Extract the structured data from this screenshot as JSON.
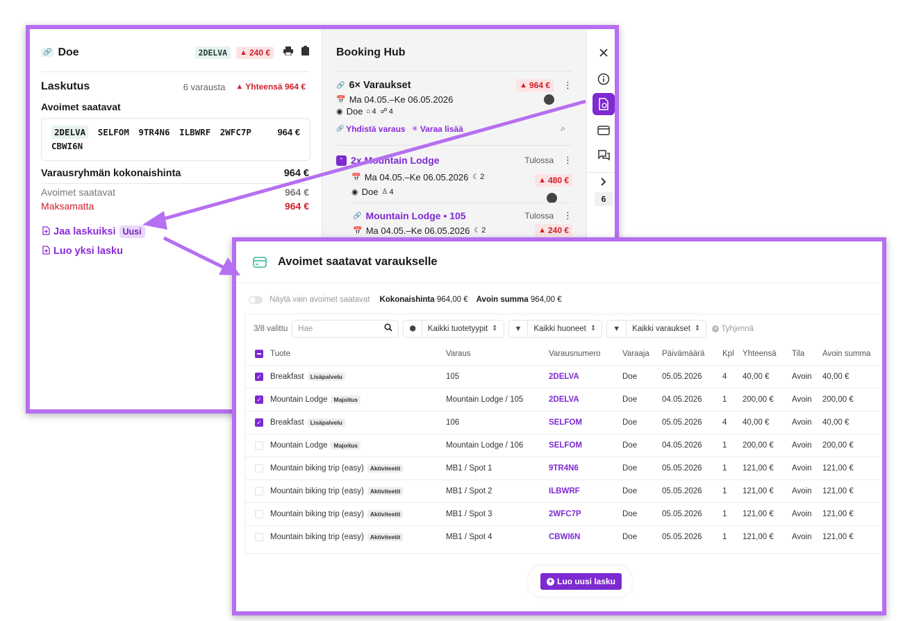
{
  "panel1": {
    "header": {
      "title": "Doe",
      "booking_code": "2DELVA",
      "balance": "240 €"
    },
    "laskutus": {
      "title": "Laskutus",
      "count": "6 varausta",
      "total": "Yhteensä 964 €"
    },
    "avoimet": {
      "title": "Avoimet saatavat",
      "codes": [
        "2DELVA",
        "SELFOM",
        "9TR4N6",
        "ILBWRF",
        "2WFC7P",
        "CBWI6N"
      ],
      "amount": "964 €"
    },
    "group_total": {
      "label": "Varausryhmän kokonaishinta",
      "amount": "964 €",
      "open_label": "Avoimet saatavat",
      "open_amount": "964 €",
      "unpaid_label": "Maksamatta",
      "unpaid_amount": "964 €"
    },
    "actions": {
      "split_label": "Jaa laskuiksi",
      "split_badge": "Uusi",
      "single_label": "Luo yksi lasku"
    },
    "hub": {
      "title": "Booking Hub",
      "group": {
        "title": "6× Varaukset",
        "balance": "964 €",
        "dates": "Ma 04.05.–Ke 06.05.2026",
        "guest": "Doe",
        "rooms": "4",
        "people": "4",
        "merge_label": "Yhdistä varaus",
        "book_more_label": "Varaa lisää"
      },
      "lodge": {
        "title": "2x Mountain Lodge",
        "status": "Tulossa",
        "dates": "Ma 04.05.–Ke 06.05.2026",
        "nights": "2",
        "balance": "480 €",
        "guest": "Doe",
        "people": "4"
      },
      "room": {
        "title": "Mountain Lodge • 105",
        "status": "Tulossa",
        "dates": "Ma 04.05.–Ke 06.05.2026",
        "nights": "2",
        "balance": "240 €"
      }
    },
    "sidebar": {
      "collapse_count": "6"
    }
  },
  "panel2": {
    "title": "Avoimet saatavat varaukselle",
    "summary": {
      "toggle_label": "Näytä vain avoimet saatavat",
      "total_label": "Kokonaishinta",
      "total_value": "964,00 €",
      "open_label": "Avoin summa",
      "open_value": "964,00 €"
    },
    "filters": {
      "selected_count": "3/8 valittu",
      "search_placeholder": "Hae",
      "product_types": "Kaikki tuotetyypit",
      "rooms": "Kaikki huoneet",
      "bookings": "Kaikki varaukset",
      "clear": "Tyhjennä"
    },
    "columns": [
      "Tuote",
      "Varaus",
      "Varausnumero",
      "Varaaja",
      "Päivämäärä",
      "Kpl",
      "Yhteensä",
      "Tila",
      "Avoin summa"
    ],
    "rows": [
      {
        "checked": true,
        "product": "Breakfast",
        "category": "Lisäpalvelu",
        "booking": "105",
        "code": "2DELVA",
        "guest": "Doe",
        "date": "05.05.2026",
        "qty": "4",
        "total": "40,00 €",
        "status": "Avoin",
        "open": "40,00 €"
      },
      {
        "checked": true,
        "product": "Mountain Lodge",
        "category": "Majoitus",
        "booking": "Mountain Lodge / 105",
        "code": "2DELVA",
        "guest": "Doe",
        "date": "04.05.2026",
        "qty": "1",
        "total": "200,00 €",
        "status": "Avoin",
        "open": "200,00 €"
      },
      {
        "checked": true,
        "product": "Breakfast",
        "category": "Lisäpalvelu",
        "booking": "106",
        "code": "SELFOM",
        "guest": "Doe",
        "date": "05.05.2026",
        "qty": "4",
        "total": "40,00 €",
        "status": "Avoin",
        "open": "40,00 €"
      },
      {
        "checked": false,
        "product": "Mountain Lodge",
        "category": "Majoitus",
        "booking": "Mountain Lodge / 106",
        "code": "SELFOM",
        "guest": "Doe",
        "date": "04.05.2026",
        "qty": "1",
        "total": "200,00 €",
        "status": "Avoin",
        "open": "200,00 €"
      },
      {
        "checked": false,
        "product": "Mountain biking trip (easy)",
        "category": "Aktiviteetit",
        "booking": "MB1 / Spot 1",
        "code": "9TR4N6",
        "guest": "Doe",
        "date": "05.05.2026",
        "qty": "1",
        "total": "121,00 €",
        "status": "Avoin",
        "open": "121,00 €"
      },
      {
        "checked": false,
        "product": "Mountain biking trip (easy)",
        "category": "Aktiviteetit",
        "booking": "MB1 / Spot 2",
        "code": "ILBWRF",
        "guest": "Doe",
        "date": "05.05.2026",
        "qty": "1",
        "total": "121,00 €",
        "status": "Avoin",
        "open": "121,00 €"
      },
      {
        "checked": false,
        "product": "Mountain biking trip (easy)",
        "category": "Aktiviteetit",
        "booking": "MB1 / Spot 3",
        "code": "2WFC7P",
        "guest": "Doe",
        "date": "05.05.2026",
        "qty": "1",
        "total": "121,00 €",
        "status": "Avoin",
        "open": "121,00 €"
      },
      {
        "checked": false,
        "product": "Mountain biking trip (easy)",
        "category": "Aktiviteetit",
        "booking": "MB1 / Spot 4",
        "code": "CBWI6N",
        "guest": "Doe",
        "date": "05.05.2026",
        "qty": "1",
        "total": "121,00 €",
        "status": "Avoin",
        "open": "121,00 €"
      }
    ],
    "create_button": "Luo uusi lasku"
  },
  "colors": {
    "accent": "#7d2ad1",
    "frame": "#b66ff0",
    "warning": "#d0202a"
  }
}
